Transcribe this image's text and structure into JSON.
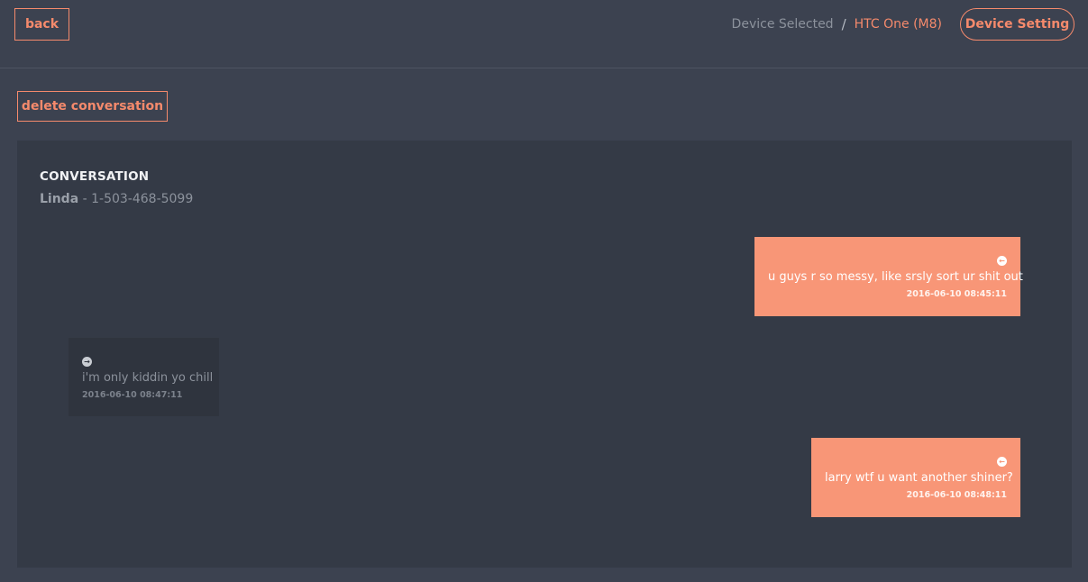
{
  "header": {
    "back_label": "back",
    "device_label": "Device Selected",
    "separator": "/",
    "device_name": "HTC One (M8)",
    "setting_label": "Device Setting"
  },
  "actions": {
    "delete_label": "delete conversation"
  },
  "conversation": {
    "title": "CONVERSATION",
    "contact_name": "Linda",
    "contact_sep": " - ",
    "contact_number": "1-503-468-5099",
    "messages": [
      {
        "direction": "out",
        "text": "u guys r so messy, like srsly sort ur shit out",
        "time": "2016-06-10 08:45:11",
        "icon": "arrow-left-circle-icon"
      },
      {
        "direction": "in",
        "text": "i'm only kiddin yo chill",
        "time": "2016-06-10 08:47:11",
        "icon": "arrow-right-circle-icon"
      },
      {
        "direction": "out",
        "text": "larry wtf u want another shiner?",
        "time": "2016-06-10 08:48:11",
        "icon": "arrow-left-circle-icon"
      }
    ]
  },
  "colors": {
    "accent": "#f58a6c",
    "background": "#3c4250",
    "panel": "#343a46",
    "outgoing_bubble": "#f89677",
    "incoming_bubble": "#2f343e"
  }
}
